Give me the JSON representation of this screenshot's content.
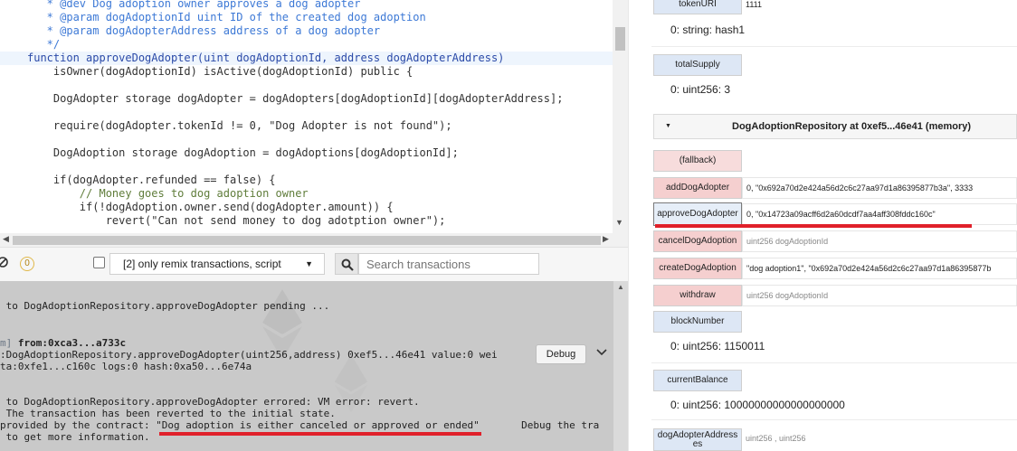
{
  "editor": {
    "lines": [
      {
        "kind": "comment",
        "text": "   * @dev Dog adoption owner approves a dog adopter"
      },
      {
        "kind": "comment",
        "text": "   * @param dogAdoptionId uint ID of the created dog adoption"
      },
      {
        "kind": "comment",
        "text": "   * @param dogAdopterAddress address of a dog adopter"
      },
      {
        "kind": "comment",
        "text": "   */"
      },
      {
        "kind": "code",
        "text": "function approveDogAdopter(uint dogAdoptionId, address dogAdopterAddress)"
      },
      {
        "kind": "code",
        "text": "    isOwner(dogAdoptionId) isActive(dogAdoptionId) public {"
      },
      {
        "kind": "blank",
        "text": ""
      },
      {
        "kind": "code",
        "text": "    DogAdopter storage dogAdopter = dogAdopters[dogAdoptionId][dogAdopterAddress];"
      },
      {
        "kind": "blank",
        "text": ""
      },
      {
        "kind": "code",
        "text": "    require(dogAdopter.tokenId != 0, \"Dog Adopter is not found\");"
      },
      {
        "kind": "blank",
        "text": ""
      },
      {
        "kind": "code",
        "text": "    DogAdoption storage dogAdoption = dogAdoptions[dogAdoptionId];"
      },
      {
        "kind": "blank",
        "text": ""
      },
      {
        "kind": "code",
        "text": "    if(dogAdopter.refunded == false) {"
      },
      {
        "kind": "comment",
        "text": "        // Money goes to dog adoption owner"
      },
      {
        "kind": "code",
        "text": "        if(!dogAdoption.owner.send(dogAdopter.amount)) {"
      },
      {
        "kind": "code",
        "text": "            revert(\"Can not send money to dog adotption owner\");"
      }
    ]
  },
  "toolbar": {
    "pending_count": "0",
    "filter_label": "[2] only remix transactions, script",
    "search_placeholder": "Search transactions"
  },
  "terminal": {
    "pending_line": " to DogAdoptionRepository.approveDogAdopter pending ...",
    "tx_line1_prefix": "m]",
    "tx_line1_rest": " from:0xca3...a733c",
    "tx_line2": ":DogAdoptionRepository.approveDogAdopter(uint256,address) 0xef5...46e41 value:0 wei",
    "tx_line3": "ta:0xfe1...c160c logs:0 hash:0xa50...6e74a",
    "debug_label": "Debug",
    "err_line1": " to DogAdoptionRepository.approveDogAdopter errored: VM error: revert.",
    "err_line2": " The transaction has been reverted to the initial state.",
    "err_line3_pre": "provided by the contract: ",
    "err_line3_msg": "\"Dog adoption is either canceled or approved or ended\"",
    "err_line3_post": "       Debug the tra",
    "err_line4": " to get more information."
  },
  "right": {
    "tokenURI": {
      "label": "tokenURI",
      "value": "1111",
      "output": "0: string: hash1"
    },
    "totalSupply": {
      "label": "totalSupply",
      "output": "0: uint256: 3"
    },
    "instance_title": "DogAdoptionRepository at 0xef5...46e41 (memory)",
    "fallback": {
      "label": "(fallback)"
    },
    "addDogAdopter": {
      "label": "addDogAdopter",
      "value": "0, \"0x692a70d2e424a56d2c6c27aa97d1a86395877b3a\", 3333"
    },
    "approveDogAdopter": {
      "label": "approveDogAdopter",
      "value": "0, \"0x14723a09acff6d2a60dcdf7aa4aff308fddc160c\""
    },
    "cancelDogAdoption": {
      "label": "cancelDogAdoption",
      "placeholder": "uint256 dogAdoptionId"
    },
    "createDogAdoption": {
      "label": "createDogAdoption",
      "value": "\"dog adoption1\", \"0x692a70d2e424a56d2c6c27aa97d1a86395877b"
    },
    "withdraw": {
      "label": "withdraw",
      "placeholder": "uint256 dogAdoptionId"
    },
    "blockNumber": {
      "label": "blockNumber",
      "output": "0: uint256: 1150011"
    },
    "currentBalance": {
      "label": "currentBalance",
      "output": "0: uint256: 10000000000000000000"
    },
    "dogAdopterAddresses": {
      "label": "dogAdopterAddresses",
      "placeholder": "uint256 , uint256"
    }
  },
  "colors": {
    "call_button": "#dde7f5",
    "tx_button": "#f5cfcf",
    "terminal_bg": "#c9c9c9",
    "highlight_red": "#e0202a"
  }
}
